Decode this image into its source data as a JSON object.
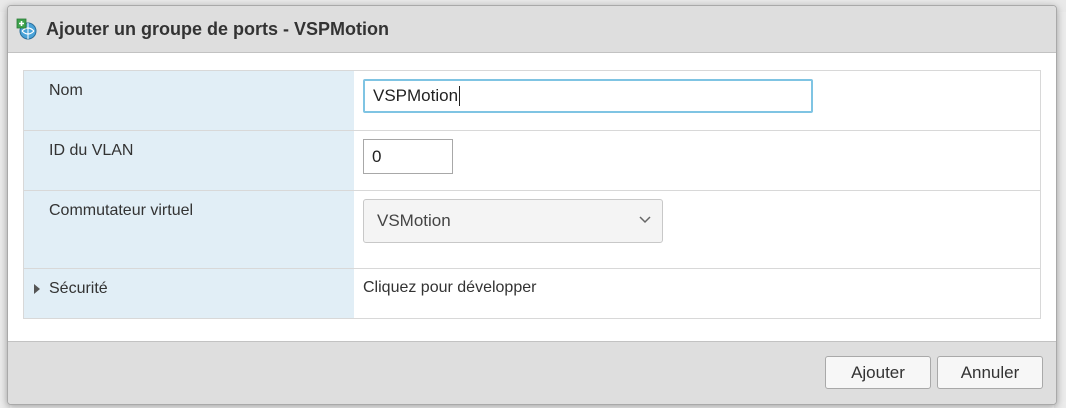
{
  "dialog": {
    "title": "Ajouter un groupe de ports - VSPMotion",
    "icon": "network-portgroup-add-icon"
  },
  "form": {
    "name": {
      "label": "Nom",
      "value": "VSPMotion"
    },
    "vlan": {
      "label": "ID du VLAN",
      "value": "0"
    },
    "vswitch": {
      "label": "Commutateur virtuel",
      "selected": "VSMotion"
    },
    "security": {
      "label": "Sécurité",
      "hint": "Cliquez pour développer"
    }
  },
  "buttons": {
    "add": "Ajouter",
    "cancel": "Annuler"
  },
  "colors": {
    "label_bg": "#e1eef6",
    "focus_border": "#7fc4e3",
    "title_bg": "#dedede"
  }
}
